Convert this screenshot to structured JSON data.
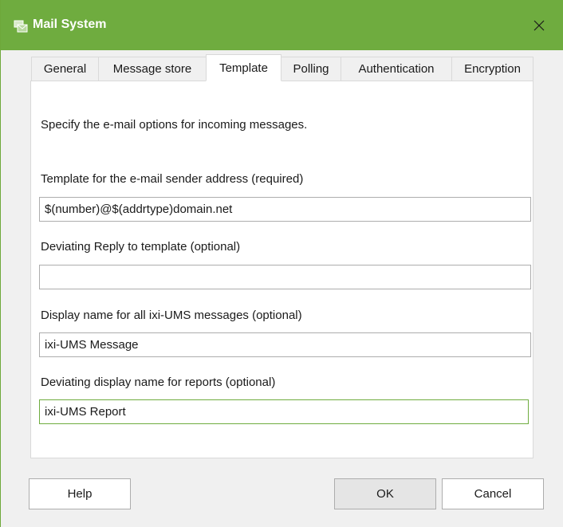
{
  "window": {
    "title": "Mail System",
    "title_icon": "mail-system-icon",
    "close_icon": "close-icon",
    "accent_color": "#6fac3f"
  },
  "tabs": [
    {
      "label": "General",
      "active": false
    },
    {
      "label": "Message store",
      "active": false
    },
    {
      "label": "Template",
      "active": true
    },
    {
      "label": "Polling",
      "active": false
    },
    {
      "label": "Authentication",
      "active": false
    },
    {
      "label": "Encryption",
      "active": false
    }
  ],
  "panel": {
    "intro": "Specify the e-mail options for incoming messages.",
    "sender_template": {
      "label": "Template for the e-mail sender address (required)",
      "value": "$(number)@$(addrtype)domain.net"
    },
    "reply_template": {
      "label": "Deviating Reply to template (optional)",
      "value": ""
    },
    "display_name": {
      "label": "Display name for all ixi-UMS messages (optional)",
      "value": "ixi-UMS Message"
    },
    "report_display_name": {
      "label": "Deviating display name for reports (optional)",
      "value": "ixi-UMS Report"
    }
  },
  "buttons": {
    "help": "Help",
    "ok": "OK",
    "cancel": "Cancel"
  }
}
